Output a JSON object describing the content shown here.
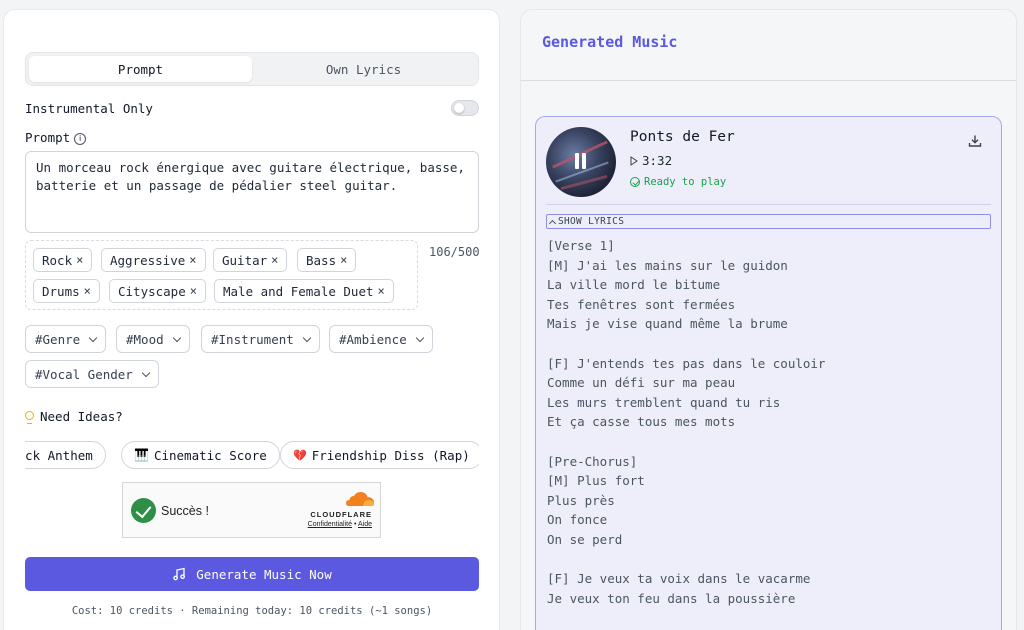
{
  "composer": {
    "tabs": [
      {
        "label": "Prompt",
        "active": true
      },
      {
        "label": "Own Lyrics",
        "active": false
      }
    ],
    "instrumental_label": "Instrumental Only",
    "instrumental_on": false,
    "prompt_label": "Prompt",
    "prompt_text": "Un morceau rock énergique avec guitare électrique, basse, batterie et un passage de pédalier steel guitar.",
    "char_count": "106/500",
    "tags": [
      "Rock",
      "Aggressive",
      "Guitar",
      "Bass",
      "Drums",
      "Cityscape",
      "Male and Female Duet"
    ],
    "tag_remove_symbol": "×",
    "dropdowns": [
      "#Genre",
      "#Mood",
      "#Instrument",
      "#Ambience",
      "#Vocal Gender"
    ],
    "ideas_label": "Need Ideas?",
    "ideas": [
      {
        "icon": "",
        "label": "Rock Anthem"
      },
      {
        "icon": "🎹",
        "label": "Cinematic Score"
      },
      {
        "icon": "💔",
        "label": "Friendship Diss (Rap)"
      }
    ],
    "captcha": {
      "status": "Succès !",
      "brand": "CLOUDFLARE",
      "privacy": "Confidentialité",
      "separator": "•",
      "help": "Aide"
    },
    "generate_label": "Generate Music Now",
    "cost_text": "Cost: 10 credits · Remaining today: 10 credits (~1 songs)"
  },
  "output": {
    "title": "Generated Music",
    "track": {
      "title": "Ponts de Fer",
      "duration": "3:32",
      "status": "Ready to play",
      "lyrics_toggle": "SHOW LYRICS",
      "lyrics": [
        "[Verse 1]",
        "[M] J'ai les mains sur le guidon",
        "La ville mord le bitume",
        "Tes fenêtres sont fermées",
        "Mais je vise quand même la brume",
        "",
        "[F] J'entends tes pas dans le couloir",
        "Comme un défi sur ma peau",
        "Les murs tremblent quand tu ris",
        "Et ça casse tous mes mots",
        "",
        "[Pre-Chorus]",
        "[M] Plus fort",
        "Plus près",
        "On fonce",
        "On se perd",
        "",
        "[F] Je veux ta voix dans le vacarme",
        "Je veux ton feu dans la poussière"
      ]
    }
  },
  "colors": {
    "accent": "#5b59e0",
    "success": "#16a34a",
    "card_border": "#a5a8ef",
    "card_bg": "#eeeefa"
  }
}
